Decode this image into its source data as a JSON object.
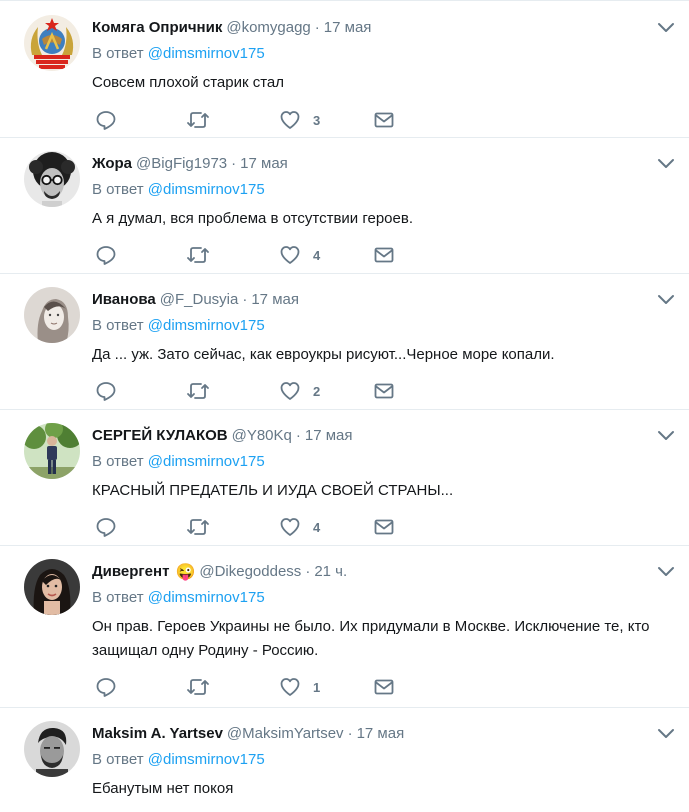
{
  "reply_prefix": "В ответ",
  "reply_mention": "@dimsmirnov175",
  "tweets": [
    {
      "name": "Комяга Опричник",
      "handle": "@komygagg",
      "time": "17 мая",
      "text": "Совсем плохой старик стал",
      "likes": "3",
      "avatar": "soviet-emblem"
    },
    {
      "name": "Жора",
      "handle": "@BigFig1973",
      "time": "17 мая",
      "text": "А я думал, вся проблема в отсутствии героев.",
      "likes": "4",
      "avatar": "man-curly-hair-glasses"
    },
    {
      "name": "Иванова",
      "handle": "@F_Dusyia",
      "time": "17 мая",
      "text": "Да ... уж. Зато сейчас, как евроукры рисуют...Черное море копали.",
      "likes": "2",
      "avatar": "sketch-portrait"
    },
    {
      "name": "СЕРГЕЙ КУЛАКОВ",
      "handle": "@Y80Kq",
      "time": "17 мая",
      "text": "КРАСНЫЙ ПРЕДАТЕЛЬ И ИУДА СВОЕЙ СТРАНЫ...",
      "likes": "4",
      "avatar": "man-outdoors"
    },
    {
      "name": "Дивергент",
      "name_emoji": "😜",
      "handle": "@Dikegoddess",
      "time": "21 ч.",
      "text": "Он прав. Героев Украины не было. Их придумали в Москве. Исключение те, кто защищал одну Родину - Россию.",
      "likes": "1",
      "avatar": "woman-portrait"
    },
    {
      "name": "Maksim A. Yartsev",
      "handle": "@MaksimYartsev",
      "time": "17 мая",
      "text": "Ебанутым нет покоя",
      "likes": "",
      "avatar": "man-bw-portrait"
    }
  ]
}
